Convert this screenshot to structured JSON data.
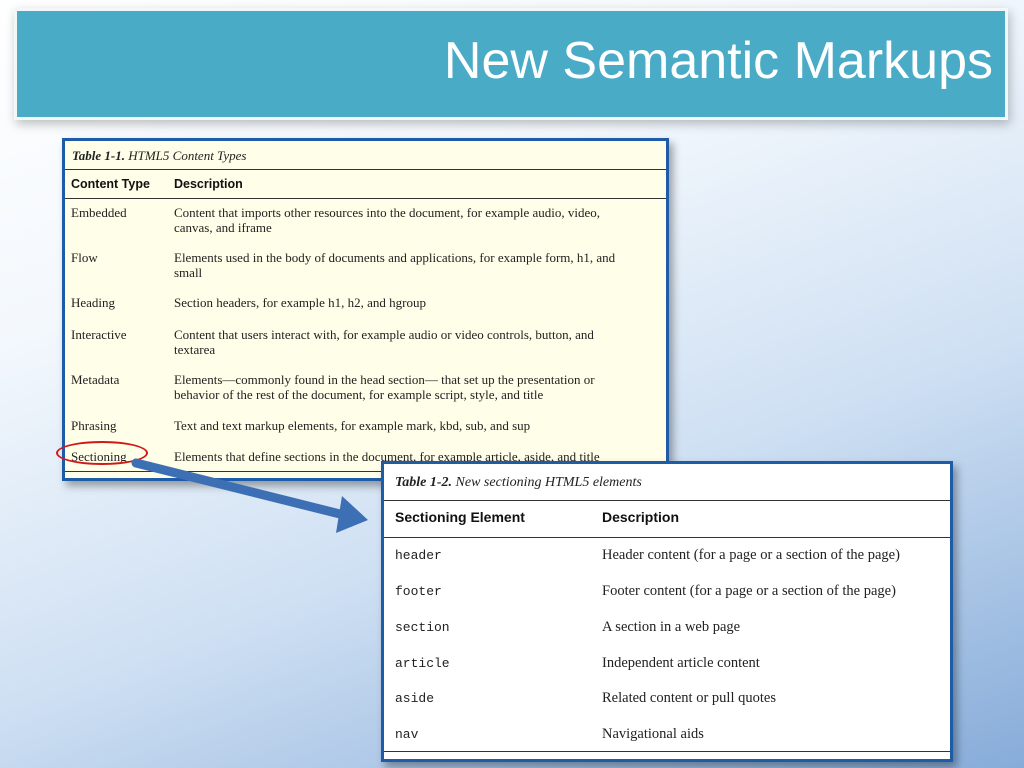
{
  "slide": {
    "title": "New Semantic Markups"
  },
  "table1": {
    "caption_bold": "Table 1-1.",
    "caption_text": "HTML5 Content Types",
    "headers": [
      "Content Type",
      "Description"
    ],
    "rows": [
      {
        "type": "Embedded",
        "desc": [
          "Content that imports other resources into the document, for example audio, video,",
          "canvas, and iframe"
        ]
      },
      {
        "type": "Flow",
        "desc": [
          "Elements used in the body of documents and applications, for example form, h1, and",
          "small"
        ]
      },
      {
        "type": "Heading",
        "desc": [
          "Section headers, for example h1, h2, and hgroup"
        ]
      },
      {
        "type": "Interactive",
        "desc": [
          "Content that users interact with, for example audio or video controls, button, and",
          "textarea"
        ]
      },
      {
        "type": "Metadata",
        "desc": [
          "Elements—commonly found in the head section— that set up the presentation or",
          "behavior of the rest of the document, for example script, style, and title"
        ]
      },
      {
        "type": "Phrasing",
        "desc": [
          "Text and text markup elements, for example mark, kbd, sub, and sup"
        ]
      },
      {
        "type": "Sectioning",
        "desc": [
          "Elements that define sections in the document, for example article, aside, and title"
        ]
      }
    ]
  },
  "table2": {
    "caption_bold": "Table 1-2.",
    "caption_text": "New sectioning HTML5 elements",
    "headers": [
      "Sectioning Element",
      "Description"
    ],
    "rows": [
      {
        "element": "header",
        "desc": "Header content (for a page or a section of the page)"
      },
      {
        "element": "footer",
        "desc": "Footer content (for a page or a section of the page)"
      },
      {
        "element": "section",
        "desc": "A section in a web page"
      },
      {
        "element": "article",
        "desc": "Independent article content"
      },
      {
        "element": "aside",
        "desc": "Related content or pull quotes"
      },
      {
        "element": "nav",
        "desc": "Navigational aids"
      }
    ]
  },
  "annotation": {
    "ellipse_color": "#d01818",
    "arrow_color": "#3d6fb5"
  }
}
